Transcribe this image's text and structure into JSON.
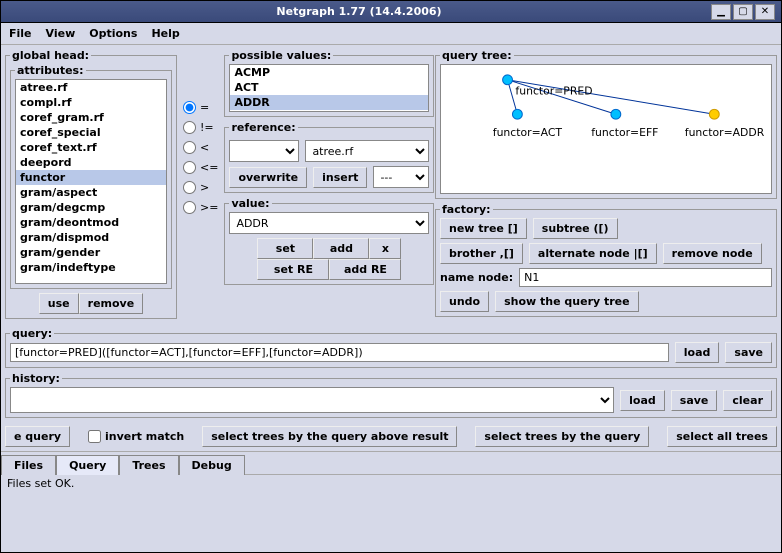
{
  "window": {
    "title": "Netgraph 1.77 (14.4.2006)"
  },
  "menu": {
    "file": "File",
    "view": "View",
    "options": "Options",
    "help": "Help"
  },
  "globalHead": {
    "legend": "global head:",
    "attrLegend": "attributes:",
    "items": [
      "atree.rf",
      "compl.rf",
      "coref_gram.rf",
      "coref_special",
      "coref_text.rf",
      "deepord",
      "functor",
      "gram/aspect",
      "gram/degcmp",
      "gram/deontmod",
      "gram/dispmod",
      "gram/gender",
      "gram/indeftype"
    ],
    "selected": "functor",
    "use": "use",
    "remove": "remove"
  },
  "operators": {
    "eq": "=",
    "ne": "!=",
    "lt": "<",
    "le": "<=",
    "gt": ">",
    "ge": ">="
  },
  "possible": {
    "legend": "possible values:",
    "items": [
      "ACMP",
      "ACT",
      "ADDR"
    ],
    "selected": "ADDR"
  },
  "reference": {
    "legend": "reference:",
    "combo2": "atree.rf",
    "overwrite": "overwrite",
    "insert": "insert",
    "dashes": "---"
  },
  "value": {
    "legend": "value:",
    "val": "ADDR",
    "set": "set",
    "add": "add",
    "x": "x",
    "setRE": "set RE",
    "addRE": "add RE"
  },
  "queryTree": {
    "legend": "query tree:",
    "nodes": {
      "root": "functor=PRED",
      "a": "functor=ACT",
      "b": "functor=EFF",
      "c": "functor=ADDR"
    }
  },
  "factory": {
    "legend": "factory:",
    "newtree": "new tree []",
    "subtree": "subtree ([)",
    "brother": "brother ,[]",
    "altnode": "alternate node |[]",
    "removenode": "remove node",
    "namenode": "name node:",
    "n1": "N1",
    "undo": "undo",
    "showtree": "show the query tree"
  },
  "query": {
    "legend": "query:",
    "text": "[functor=PRED]([functor=ACT],[functor=EFF],[functor=ADDR])",
    "load": "load",
    "save": "save"
  },
  "history": {
    "legend": "history:",
    "load": "load",
    "save": "save",
    "clear": "clear"
  },
  "bottomBtns": {
    "equery": "e query",
    "invert": "invert match",
    "selAbove": "select trees by the query above result",
    "selBy": "select trees by the query",
    "selAll": "select all trees"
  },
  "tabs": {
    "files": "Files",
    "query": "Query",
    "trees": "Trees",
    "debug": "Debug"
  },
  "status": "Files set OK."
}
